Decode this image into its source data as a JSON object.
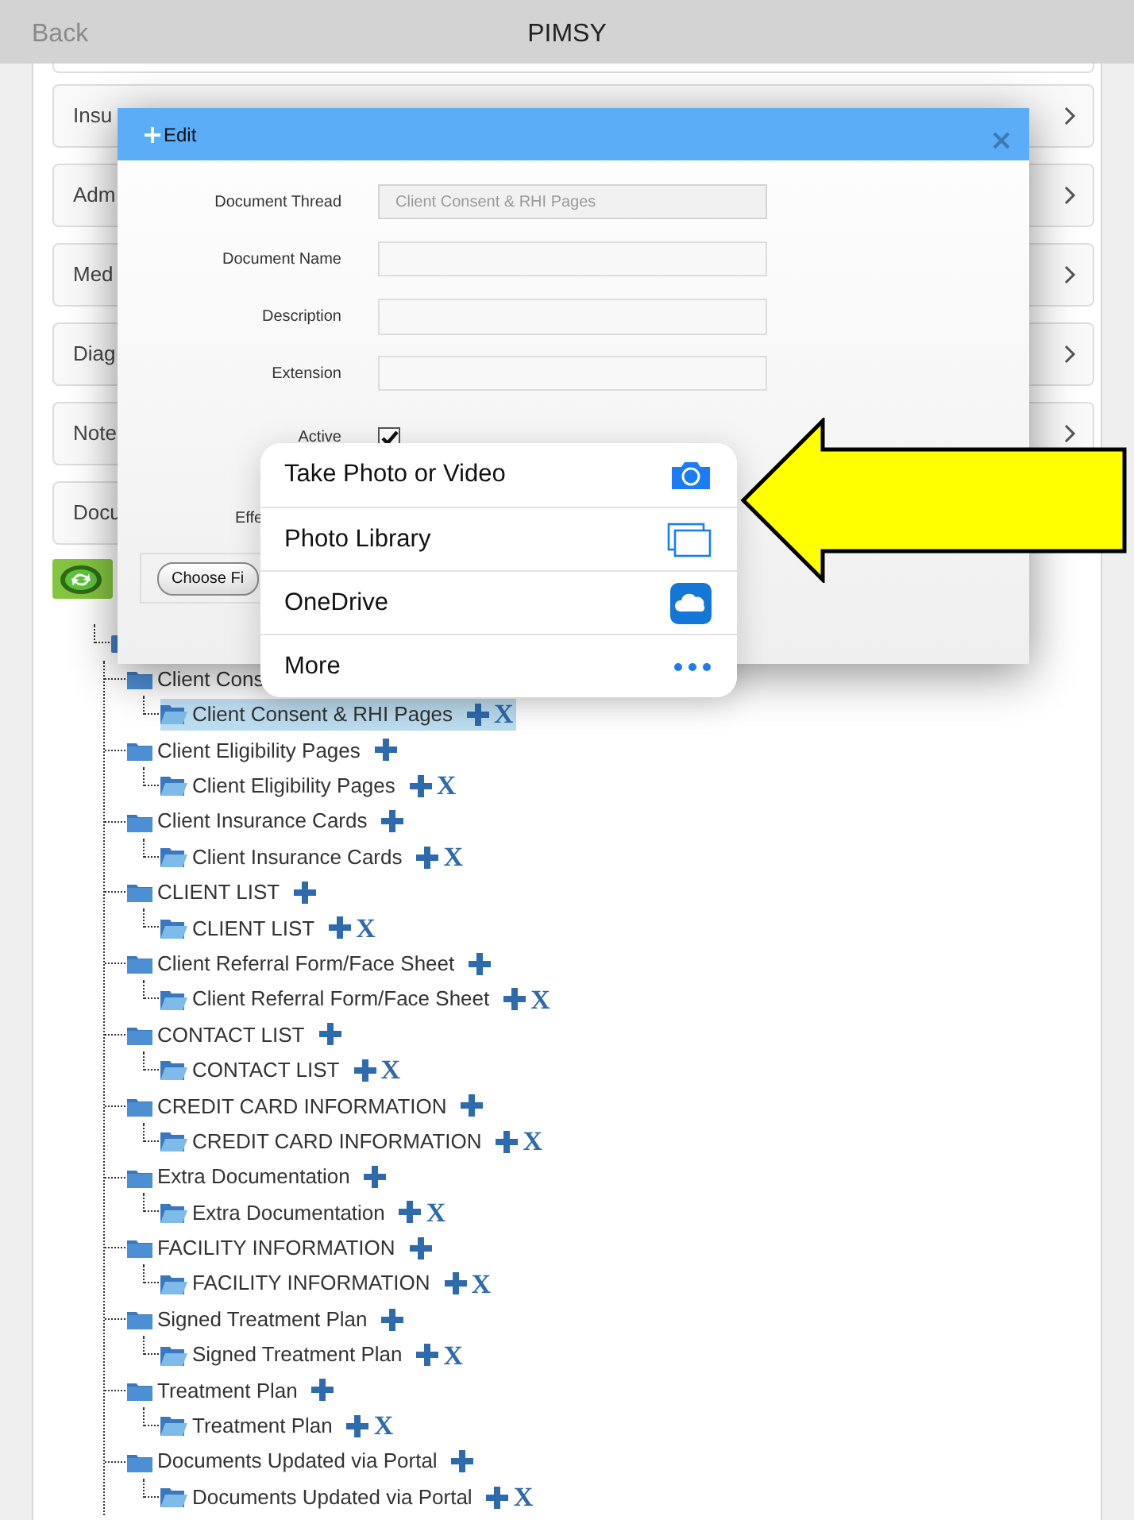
{
  "header": {
    "back": "Back",
    "title": "PIMSY"
  },
  "sections": [
    {
      "label": "Insu",
      "chevron": true
    },
    {
      "label": "Adm",
      "chevron": true
    },
    {
      "label": "Med",
      "chevron": true
    },
    {
      "label": "Diag",
      "chevron": true
    },
    {
      "label": "Note",
      "chevron": true
    },
    {
      "label": "Docu",
      "chevron": false
    }
  ],
  "tree": {
    "groups": [
      {
        "label": "Client Cons",
        "add": false,
        "children": [
          {
            "label": "Client Consent & RHI Pages",
            "selected": true,
            "delete": "X"
          }
        ]
      },
      {
        "label": "Client Eligibility Pages",
        "add": true,
        "children": [
          {
            "label": "Client Eligibility Pages",
            "selected": false,
            "delete": "X"
          }
        ]
      },
      {
        "label": "Client Insurance Cards",
        "add": true,
        "children": [
          {
            "label": "Client Insurance Cards",
            "selected": false,
            "delete": "X"
          }
        ]
      },
      {
        "label": "CLIENT LIST",
        "add": true,
        "children": [
          {
            "label": "CLIENT LIST",
            "selected": false,
            "delete": "X"
          }
        ]
      },
      {
        "label": "Client Referral Form/Face Sheet",
        "add": true,
        "children": [
          {
            "label": "Client Referral Form/Face Sheet",
            "selected": false,
            "delete": "X"
          }
        ]
      },
      {
        "label": "CONTACT LIST",
        "add": true,
        "children": [
          {
            "label": "CONTACT LIST",
            "selected": false,
            "delete": "X"
          }
        ]
      },
      {
        "label": "CREDIT CARD INFORMATION",
        "add": true,
        "children": [
          {
            "label": "CREDIT CARD INFORMATION",
            "selected": false,
            "delete": "X"
          }
        ]
      },
      {
        "label": "Extra Documentation",
        "add": true,
        "children": [
          {
            "label": "Extra Documentation",
            "selected": false,
            "delete": "X"
          }
        ]
      },
      {
        "label": "FACILITY INFORMATION",
        "add": true,
        "children": [
          {
            "label": "FACILITY INFORMATION",
            "selected": false,
            "delete": "X"
          }
        ]
      },
      {
        "label": "Signed Treatment Plan",
        "add": true,
        "children": [
          {
            "label": "Signed Treatment Plan",
            "selected": false,
            "delete": "X"
          }
        ]
      },
      {
        "label": "Treatment Plan",
        "add": true,
        "children": [
          {
            "label": "Treatment Plan",
            "selected": false,
            "delete": "X"
          }
        ]
      },
      {
        "label": "Documents Updated via Portal",
        "add": true,
        "children": [
          {
            "label": "Documents Updated via Portal",
            "selected": false,
            "delete": "X"
          }
        ]
      }
    ]
  },
  "modal": {
    "title": "Edit",
    "fields": [
      {
        "label": "Document Thread",
        "kind": "text",
        "value": "Client Consent & RHI Pages",
        "disabled": true
      },
      {
        "label": "Document Name",
        "kind": "text"
      },
      {
        "label": "Description",
        "kind": "textarea"
      },
      {
        "label": "Extension",
        "kind": "text"
      },
      {
        "label": "Active",
        "kind": "checkbox",
        "checked": true
      },
      {
        "label": "Effe",
        "kind": "label"
      }
    ],
    "file_button": "Choose Fi"
  },
  "action_sheet": {
    "items": [
      {
        "label": "Take Photo or Video",
        "kind": "camera"
      },
      {
        "label": "Photo Library",
        "kind": "library"
      },
      {
        "label": "OneDrive",
        "kind": "cloud"
      },
      {
        "label": "More",
        "kind": "more"
      }
    ]
  }
}
